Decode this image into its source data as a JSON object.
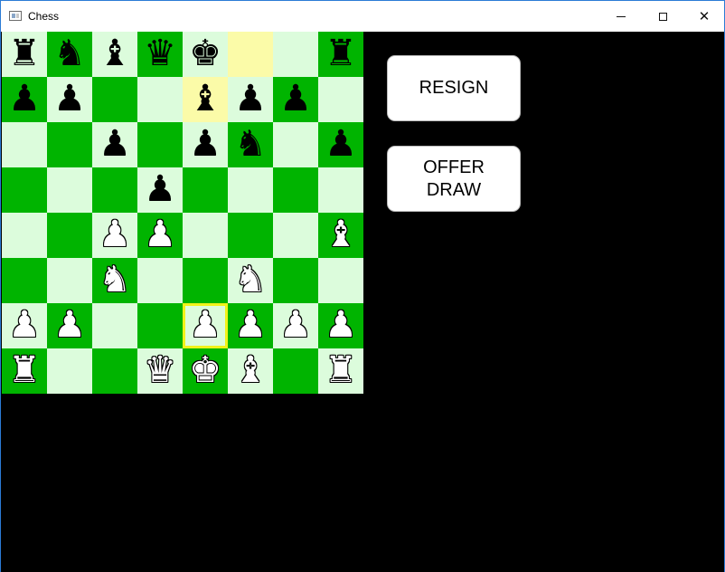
{
  "window": {
    "title": "Chess",
    "controls": {
      "minimize": "",
      "maximize": "",
      "close": "✕"
    }
  },
  "board": {
    "ranks": [
      [
        "br",
        "bn",
        "bb",
        "bq",
        "bk",
        "",
        "",
        "br"
      ],
      [
        "bp",
        "bp",
        "",
        "",
        "bb",
        "bp",
        "bp",
        ""
      ],
      [
        "",
        "",
        "bp",
        "",
        "bp",
        "bn",
        "",
        "bp"
      ],
      [
        "",
        "",
        "",
        "bp",
        "",
        "",
        "",
        ""
      ],
      [
        "",
        "",
        "wp",
        "wp",
        "",
        "",
        "",
        "wb"
      ],
      [
        "",
        "",
        "wn",
        "",
        "",
        "wn",
        "",
        ""
      ],
      [
        "wp",
        "wp",
        "",
        "",
        "wp",
        "wp",
        "wp",
        "wp"
      ],
      [
        "wr",
        "",
        "",
        "wq",
        "wk",
        "wb",
        "",
        "wr"
      ]
    ],
    "highlighted_squares": [
      "f8",
      "e7"
    ],
    "selected_square": "e2",
    "colors": {
      "light": "#dcfcdc",
      "dark": "#00b400",
      "highlight": "#fbfba8",
      "selected_border": "#f2f21a"
    }
  },
  "buttons": {
    "resign": "RESIGN",
    "offer_draw_line1": "OFFER",
    "offer_draw_line2": "DRAW"
  }
}
